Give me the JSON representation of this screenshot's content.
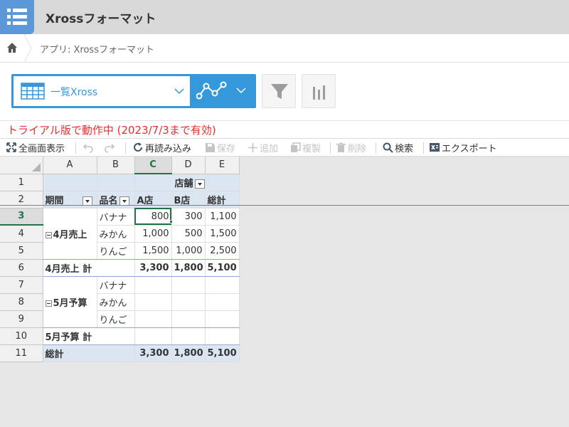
{
  "app": {
    "title": "Xrossフォーマット",
    "icon": "list-icon"
  },
  "breadcrumb": {
    "text": "アプリ: Xrossフォーマット"
  },
  "view": {
    "label": "一覧Xross",
    "graph_icon": "graph-icon",
    "filter_icon": "funnel-icon",
    "chart_icon": "bar-chart-icon"
  },
  "trial": {
    "message": "トライアル版で動作中 (2023/7/3まで有効)"
  },
  "toolbar": {
    "fullscreen": "全画面表示",
    "reload": "再読み込み",
    "save": "保存",
    "add": "追加",
    "copy": "複製",
    "delete": "削除",
    "search": "検索",
    "export": "エクスポート"
  },
  "grid": {
    "columns": [
      "A",
      "B",
      "C",
      "D",
      "E"
    ],
    "row_numbers": [
      "1",
      "2",
      "3",
      "4",
      "5",
      "6",
      "7",
      "8",
      "9",
      "10",
      "11"
    ],
    "header_store": "店舗",
    "header_period": "期間",
    "header_item": "品名",
    "header_a": "A店",
    "header_b": "B店",
    "header_total": "総計",
    "april": {
      "label": "4月売上",
      "rows": [
        {
          "item": "バナナ",
          "a": "800",
          "b": "300",
          "total": "1,100"
        },
        {
          "item": "みかん",
          "a": "1,000",
          "b": "500",
          "total": "1,500"
        },
        {
          "item": "りんご",
          "a": "1,500",
          "b": "1,000",
          "total": "2,500"
        }
      ],
      "subtotal_label": "4月売上 計",
      "subtotal": {
        "a": "3,300",
        "b": "1,800",
        "total": "5,100"
      }
    },
    "may": {
      "label": "5月予算",
      "rows": [
        {
          "item": "バナナ"
        },
        {
          "item": "みかん"
        },
        {
          "item": "りんご"
        }
      ],
      "subtotal_label": "5月予算 計"
    },
    "grand_total_label": "総計",
    "grand_total": {
      "a": "3,300",
      "b": "1,800",
      "total": "5,100"
    }
  }
}
